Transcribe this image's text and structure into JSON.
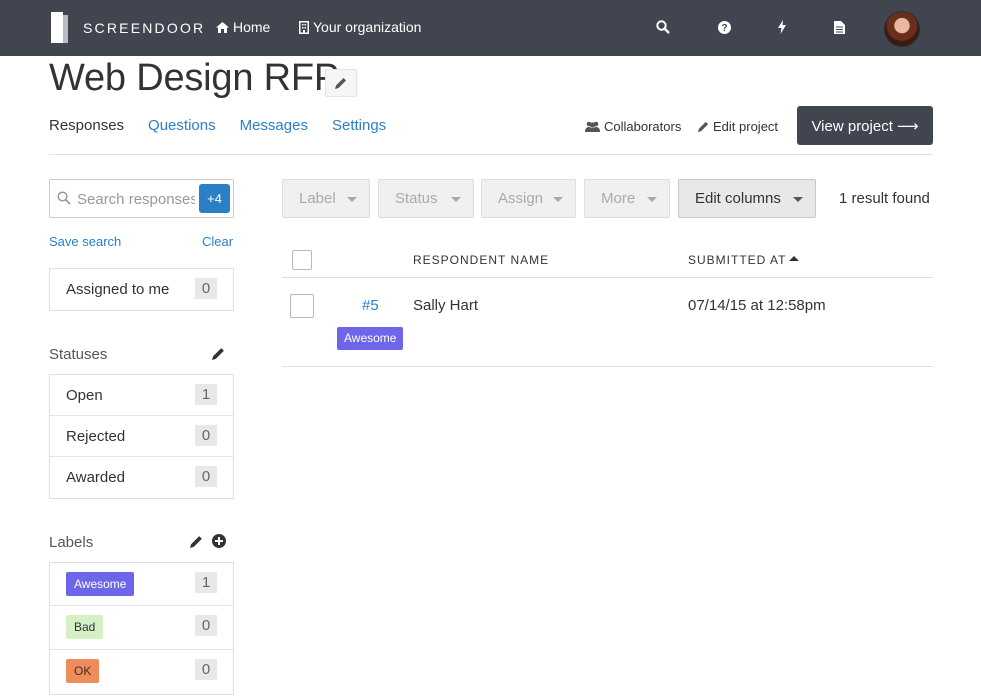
{
  "topbar": {
    "brand": "SCREENDOOR",
    "nav": [
      {
        "label": "Home",
        "icon": "home-icon"
      },
      {
        "label": "Your organization",
        "icon": "building-icon"
      }
    ],
    "icons": [
      "search-icon",
      "help-icon",
      "lightning-icon",
      "document-icon"
    ]
  },
  "project": {
    "title": "Web Design RFP",
    "tabs": [
      "Responses",
      "Questions",
      "Messages",
      "Settings"
    ],
    "active_tab": "Responses",
    "collaborators_label": "Collaborators",
    "edit_project_label": "Edit project",
    "view_project_label": "View project ⟶"
  },
  "sidebar": {
    "search_placeholder": "Search responses",
    "filter_badge": "+4",
    "save_search": "Save search",
    "clear": "Clear",
    "assigned": {
      "label": "Assigned to me",
      "count": "0"
    },
    "statuses_heading": "Statuses",
    "statuses": [
      {
        "label": "Open",
        "count": "1"
      },
      {
        "label": "Rejected",
        "count": "0"
      },
      {
        "label": "Awarded",
        "count": "0"
      }
    ],
    "labels_heading": "Labels",
    "labels": [
      {
        "label": "Awesome",
        "count": "1",
        "bg": "#6e66ea",
        "fg": "#ffffff"
      },
      {
        "label": "Bad",
        "count": "0",
        "bg": "#d6f0c6",
        "fg": "#333333"
      },
      {
        "label": "OK",
        "count": "0",
        "bg": "#f08c5a",
        "fg": "#333333"
      }
    ]
  },
  "toolbar": {
    "label": "Label",
    "status": "Status",
    "assign": "Assign",
    "more": "More",
    "edit_columns": "Edit columns",
    "result_count": "1 result found"
  },
  "table": {
    "columns": [
      "RESPONDENT NAME",
      "SUBMITTED AT"
    ],
    "rows": [
      {
        "id": "#5",
        "name": "Sally Hart",
        "submitted": "07/14/15 at 12:58pm",
        "tag": "Awesome"
      }
    ]
  },
  "colors": {
    "topbar": "#40454f",
    "link": "#2a7fc5",
    "accent_tag": "#6e66ea"
  }
}
